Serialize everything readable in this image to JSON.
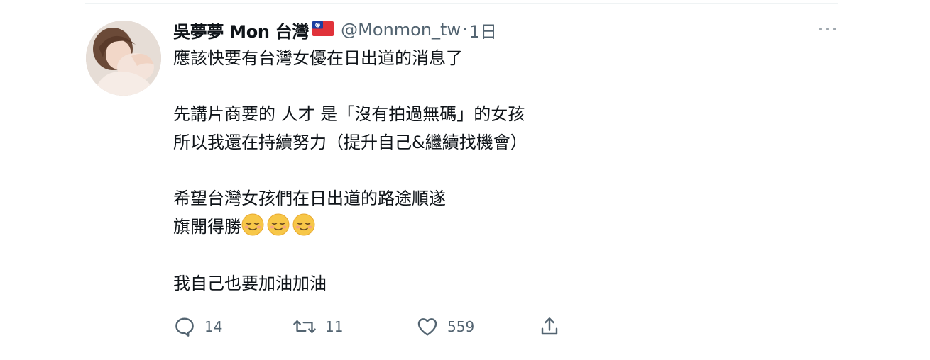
{
  "tweet": {
    "display_name": "吳夢夢 Mon 台灣",
    "flag_icon": "taiwan-flag-icon",
    "handle": "@Monmon_tw",
    "separator": "·",
    "time": "1日",
    "lines": [
      "應該快要有台灣女優在日出道的消息了",
      "",
      "先講片商要的 人才 是「沒有拍過無碼」的女孩",
      "所以我還在持續努力（提升自己&繼續找機會）",
      "",
      "希望台灣女孩們在日出道的路途順遂",
      "旗開得勝",
      "",
      "我自己也要加油加油"
    ],
    "emoji_line_icons": [
      "smiling-face-icon",
      "smiling-face-icon",
      "smiling-face-icon"
    ],
    "actions": {
      "reply_count": "14",
      "retweet_count": "11",
      "like_count": "559"
    }
  },
  "colors": {
    "text": "#0f1419",
    "secondary": "#536471",
    "divider": "#eff3f4"
  }
}
